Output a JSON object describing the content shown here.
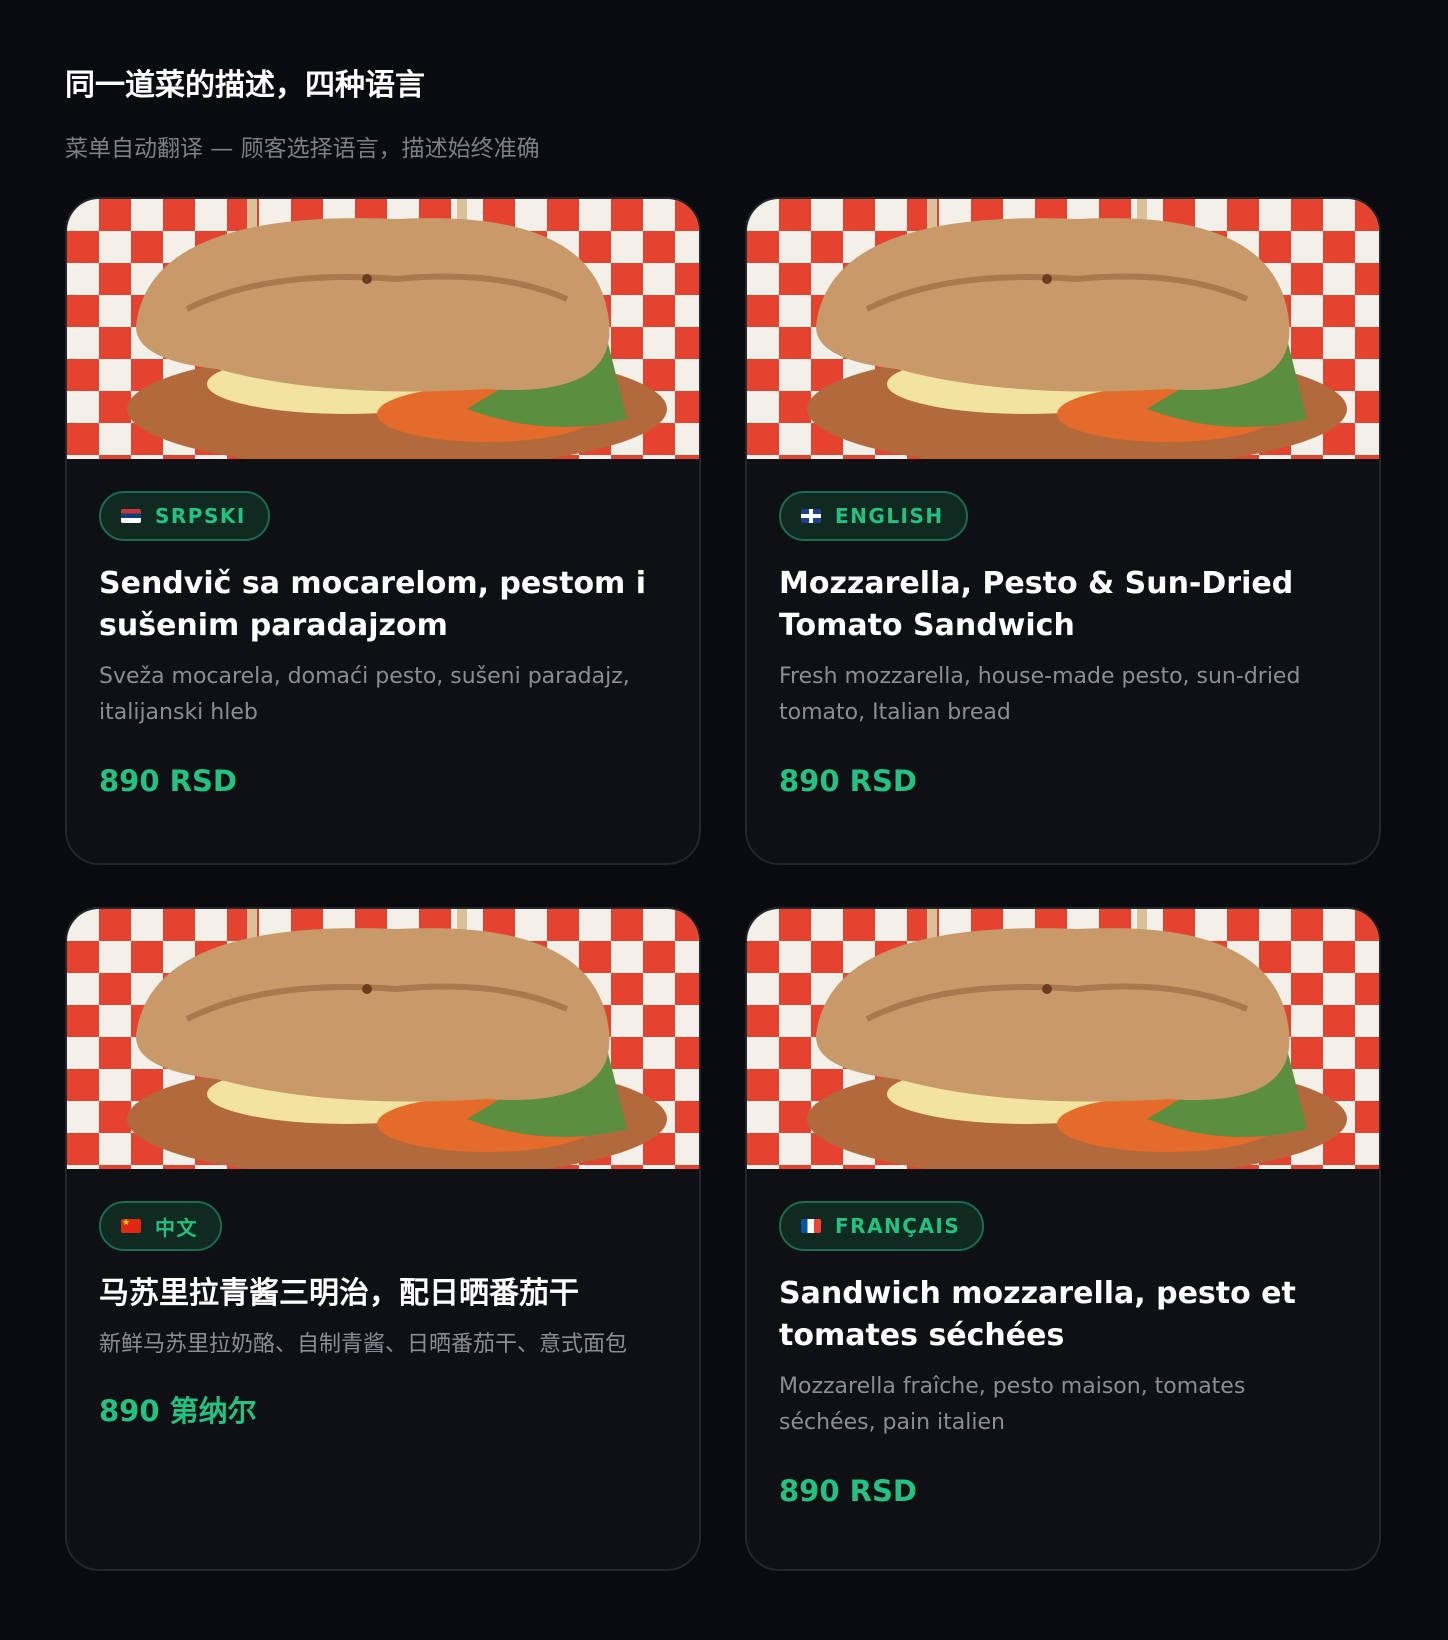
{
  "header": {
    "title": "同一道菜的描述，四种语言",
    "subtitle": "菜单自动翻译 — 顾客选择语言，描述始终准确"
  },
  "cards": [
    {
      "language": "SRPSKI",
      "flag": "serbia-flag-icon",
      "name": "Sendvič sa mocarelom, pestom i sušenim paradajzom",
      "description": "Sveža mocarela, domaći pesto, sušeni paradajz, italijanski hleb",
      "price": "890 RSD"
    },
    {
      "language": "ENGLISH",
      "flag": "uk-flag-icon",
      "name": "Mozzarella, Pesto & Sun-Dried Tomato Sandwich",
      "description": "Fresh mozzarella, house-made pesto, sun-dried tomato, Italian bread",
      "price": "890 RSD"
    },
    {
      "language": "中文",
      "flag": "china-flag-icon",
      "name": "马苏里拉青酱三明治，配日晒番茄干",
      "description": "新鲜马苏里拉奶酪、自制青酱、日晒番茄干、意式面包",
      "price": "890 第纳尔"
    },
    {
      "language": "FRANÇAIS",
      "flag": "france-flag-icon",
      "name": "Sandwich mozzarella, pesto et tomates séchées",
      "description": "Mozzarella fraîche, pesto maison, tomates séchées, pain italien",
      "price": "890 RSD"
    }
  ],
  "colors": {
    "background": "#0a0b0f",
    "card": "#0e1014",
    "accent": "#22c283",
    "badge_bg": "#0f2a21",
    "badge_border": "#1b6b4e",
    "muted_text": "#8a8d94"
  }
}
